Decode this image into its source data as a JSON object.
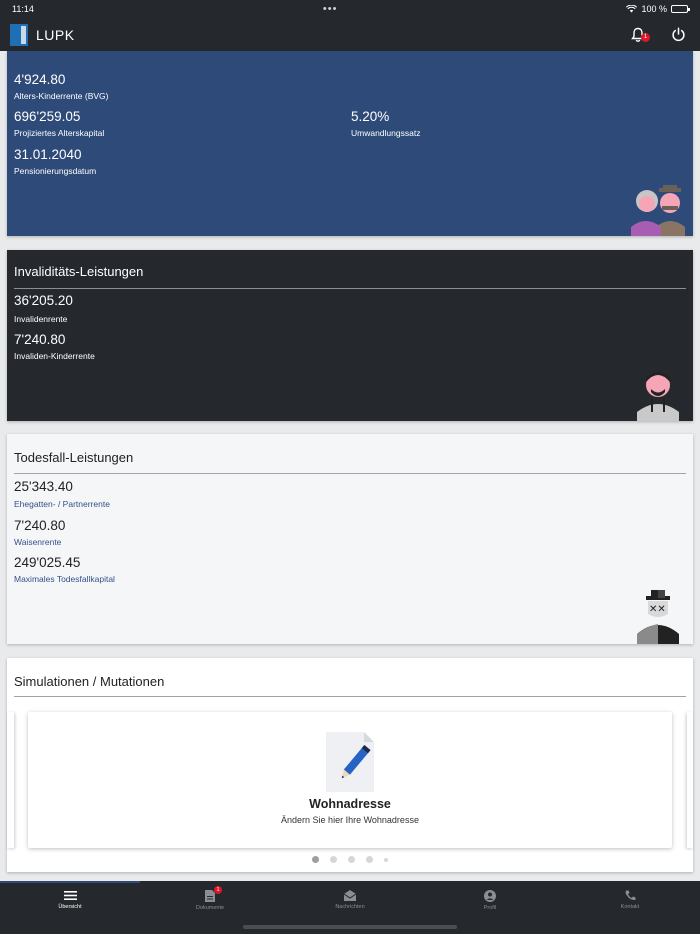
{
  "status_bar": {
    "time": "11:14",
    "dots": "•••",
    "battery_percent": "100 %"
  },
  "app_bar": {
    "title": "LUPK",
    "notification_count": "1"
  },
  "retirement": {
    "items": [
      {
        "value": "4'924.80",
        "label": "Alters-Kinderrente (BVG)"
      },
      {
        "value": "696'259.05",
        "label": "Projiziertes Alterskapital"
      },
      {
        "value": "5.20%",
        "label": "Umwandlungssatz"
      },
      {
        "value": "31.01.2040",
        "label": "Pensionierungsdatum"
      }
    ]
  },
  "disability": {
    "title": "Invaliditäts-Leistungen",
    "items": [
      {
        "value": "36'205.20",
        "label": "Invalidenrente"
      },
      {
        "value": "7'240.80",
        "label": "Invaliden-Kinderrente"
      }
    ]
  },
  "death": {
    "title": "Todesfall-Leistungen",
    "items": [
      {
        "value": "25'343.40",
        "label": "Ehegatten- / Partnerrente"
      },
      {
        "value": "7'240.80",
        "label": "Waisenrente"
      },
      {
        "value": "249'025.45",
        "label": "Maximales Todesfallkapital"
      }
    ]
  },
  "simulations": {
    "title": "Simulationen / Mutationen",
    "card_title": "Wohnadresse",
    "card_desc": "Ändern Sie hier Ihre Wohnadresse",
    "page_count": 5,
    "active_page": 1
  },
  "bottom_nav": {
    "items": [
      {
        "label": "Übersicht",
        "icon": "menu-icon",
        "active": true
      },
      {
        "label": "Dokumente",
        "icon": "document-icon",
        "badge": "1"
      },
      {
        "label": "Nachrichten",
        "icon": "mail-icon"
      },
      {
        "label": "Profil",
        "icon": "profile-icon"
      },
      {
        "label": "Kontakt",
        "icon": "phone-icon"
      }
    ]
  },
  "colors": {
    "retire_bg": "#2e4a78",
    "dark_bg": "#25282d",
    "badge": "#d8192a"
  }
}
